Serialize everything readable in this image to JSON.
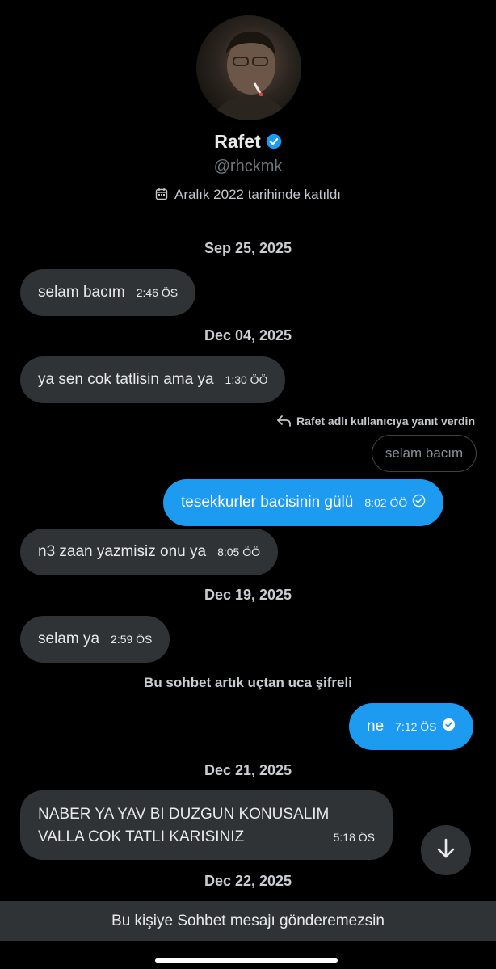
{
  "profile": {
    "name": "Rafet",
    "handle": "@rhckmk",
    "joined": "Aralık 2022 tarihinde katıldı"
  },
  "colors": {
    "accent": "#1d9bf0",
    "bubble_in": "#2f3336",
    "background": "#000000"
  },
  "messages": {
    "d1": "Sep 25, 2025",
    "m1": {
      "text": "selam bacım",
      "time": "2:46 ÖS"
    },
    "d2": "Dec 04, 2025",
    "m2": {
      "text": "ya sen cok tatlisin ama ya",
      "time": "1:30 ÖÖ"
    },
    "reply_note": "Rafet adlı kullanıcıya yanıt verdin",
    "quoted": "selam bacım",
    "m3": {
      "text": "tesekkurler bacisinin gülü",
      "time": "8:02 ÖÖ"
    },
    "m4": {
      "text": "n3 zaan yazmisiz onu ya",
      "time": "8:05 ÖÖ"
    },
    "d3": "Dec 19, 2025",
    "m5": {
      "text": "selam ya",
      "time": "2:59 ÖS"
    },
    "e2e_notice": "Bu sohbet artık uçtan uca şifreli",
    "m6": {
      "text": "ne",
      "time": "7:12 ÖS"
    },
    "d4": "Dec 21, 2025",
    "m7": {
      "line1": "NABER YA YAV BI DUZGUN KONUSALIM",
      "line2": "VALLA COK TATLI KARISINIZ",
      "time": "5:18 ÖS"
    },
    "d5": "Dec 22, 2025"
  },
  "footer": {
    "notice": "Bu kişiye Sohbet mesajı gönderemezsin"
  },
  "icons": [
    "verified-badge-icon",
    "calendar-icon",
    "reply-arrow-icon",
    "sent-check-icon",
    "read-check-icon",
    "arrow-down-icon"
  ]
}
